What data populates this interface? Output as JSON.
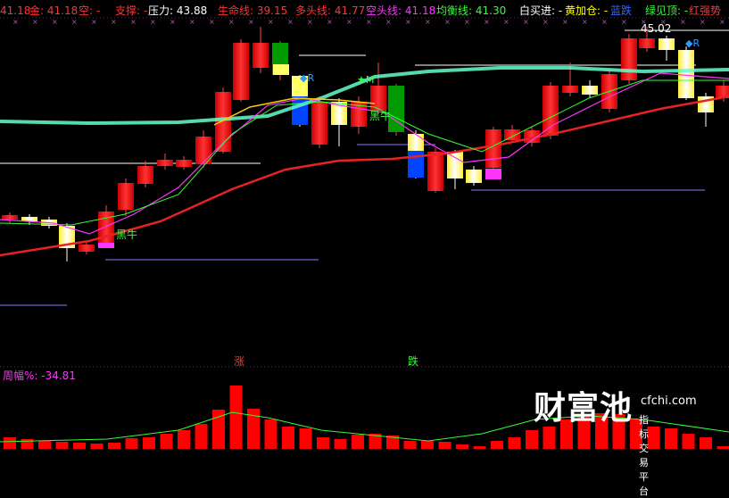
{
  "header": [
    {
      "text": "41.18",
      "color": "#ff3333"
    },
    {
      "text": "金: 41.18",
      "color": "#ff3333"
    },
    {
      "text": "空: -",
      "color": "#ff3333"
    },
    {
      "text": "支撑: -",
      "color": "#ff3333"
    },
    {
      "text": "压力: 43.88",
      "color": "#ffffff"
    },
    {
      "text": "生命线: 39.15",
      "color": "#ff3333"
    },
    {
      "text": "多头线: 41.77",
      "color": "#ff3333"
    },
    {
      "text": "空头线: 41.18",
      "color": "#ff33ff"
    },
    {
      "text": "均衡线: 41.30",
      "color": "#33ff33"
    },
    {
      "text": "白买进: -",
      "color": "#ffffff"
    },
    {
      "text": "黄加仓: -",
      "color": "#ffff00"
    },
    {
      "text": "蓝跌",
      "color": "#3366ff"
    },
    {
      "text": "绿见顶: -",
      "color": "#33ff33"
    },
    {
      "text": "红强势",
      "color": "#ff3333"
    }
  ],
  "labels": {
    "peak_price": "45.02",
    "black_bull_1": "黑牛",
    "black_bull_2": "黑牛",
    "marker_r": "R",
    "marker_m": "M",
    "rise": "涨",
    "fall": "跌",
    "lower_title": "周幅%: -34.81"
  },
  "logo": {
    "name": "财富池",
    "site": "cfchi.com",
    "tagline": "指标交易平台"
  },
  "colors": {
    "up": "#ff0000",
    "yellow": "#ffff66",
    "blue": "#0044ff",
    "green": "#009900",
    "magenta": "#ff33ff",
    "cyan": "#66ffcc",
    "life_line": "#e82222"
  }
}
